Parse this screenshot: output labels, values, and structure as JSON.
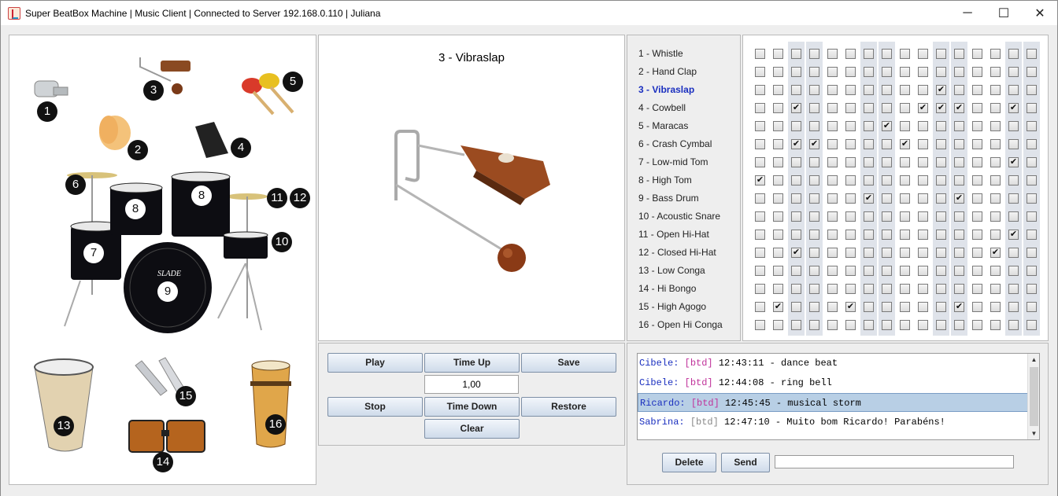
{
  "window": {
    "title": "Super BeatBox Machine | Music Client | Connected to Server 192.168.0.110 | Juliana",
    "controls": {
      "minimize": "─",
      "maximize": "☐",
      "close": "✕"
    }
  },
  "instrument_image": {
    "numbers": [
      "1",
      "2",
      "3",
      "4",
      "5",
      "6",
      "7",
      "8",
      "8",
      "9",
      "10",
      "11",
      "12",
      "13",
      "14",
      "15",
      "16"
    ],
    "brand_text": "SLADE"
  },
  "preview": {
    "title": "3 - Vibraslap"
  },
  "instruments": [
    "1 - Whistle",
    "2 - Hand Clap",
    "3 - Vibraslap",
    "4 - Cowbell",
    "5 - Maracas",
    "6 - Crash Cymbal",
    "7 - Low-mid Tom",
    "8 - High Tom",
    "9 - Bass Drum",
    "10 - Acoustic Snare",
    "11 - Open Hi-Hat",
    "12 - Closed Hi-Hat",
    "13 - Low Conga",
    "14 - Hi Bongo",
    "15 - High Agogo",
    "16 - Open Hi Conga"
  ],
  "selected_instrument_index": 2,
  "beat_grid": [
    [
      0,
      0,
      0,
      0,
      0,
      0,
      0,
      0,
      0,
      0,
      0,
      0,
      0,
      0,
      0,
      0
    ],
    [
      0,
      0,
      0,
      0,
      0,
      0,
      0,
      0,
      0,
      0,
      0,
      0,
      0,
      0,
      0,
      0
    ],
    [
      0,
      0,
      0,
      0,
      0,
      0,
      0,
      0,
      0,
      0,
      1,
      0,
      0,
      0,
      0,
      0
    ],
    [
      0,
      0,
      1,
      0,
      0,
      0,
      0,
      0,
      0,
      1,
      1,
      1,
      0,
      0,
      1,
      0
    ],
    [
      0,
      0,
      0,
      0,
      0,
      0,
      0,
      1,
      0,
      0,
      0,
      0,
      0,
      0,
      0,
      0
    ],
    [
      0,
      0,
      1,
      1,
      0,
      0,
      0,
      0,
      1,
      0,
      0,
      0,
      0,
      0,
      0,
      0
    ],
    [
      0,
      0,
      0,
      0,
      0,
      0,
      0,
      0,
      0,
      0,
      0,
      0,
      0,
      0,
      1,
      0
    ],
    [
      1,
      0,
      0,
      0,
      0,
      0,
      0,
      0,
      0,
      0,
      0,
      0,
      0,
      0,
      0,
      0
    ],
    [
      0,
      0,
      0,
      0,
      0,
      0,
      1,
      0,
      0,
      0,
      0,
      1,
      0,
      0,
      0,
      0
    ],
    [
      0,
      0,
      0,
      0,
      0,
      0,
      0,
      0,
      0,
      0,
      0,
      0,
      0,
      0,
      0,
      0
    ],
    [
      0,
      0,
      0,
      0,
      0,
      0,
      0,
      0,
      0,
      0,
      0,
      0,
      0,
      0,
      1,
      0
    ],
    [
      0,
      0,
      1,
      0,
      0,
      0,
      0,
      0,
      0,
      0,
      0,
      0,
      0,
      1,
      0,
      0
    ],
    [
      0,
      0,
      0,
      0,
      0,
      0,
      0,
      0,
      0,
      0,
      0,
      0,
      0,
      0,
      0,
      0
    ],
    [
      0,
      0,
      0,
      0,
      0,
      0,
      0,
      0,
      0,
      0,
      0,
      0,
      0,
      0,
      0,
      0
    ],
    [
      0,
      1,
      0,
      0,
      0,
      1,
      0,
      0,
      0,
      0,
      0,
      1,
      0,
      0,
      0,
      0
    ],
    [
      0,
      0,
      0,
      0,
      0,
      0,
      0,
      0,
      0,
      0,
      0,
      0,
      0,
      0,
      0,
      0
    ]
  ],
  "check_mark": "✔",
  "controls": {
    "play": "Play",
    "time_up": "Time Up",
    "save": "Save",
    "tempo": "1,00",
    "stop": "Stop",
    "time_down": "Time Down",
    "restore": "Restore",
    "clear": "Clear"
  },
  "chat": {
    "messages": [
      {
        "user": "Cibele:",
        "tag": "[btd]",
        "tag_color": "#c0339b",
        "time": "12:43:11",
        "text": "- dance beat"
      },
      {
        "user": "Cibele:",
        "tag": "[btd]",
        "tag_color": "#c0339b",
        "time": "12:44:08",
        "text": "- ring bell"
      },
      {
        "user": "Ricardo:",
        "tag": "[btd]",
        "tag_color": "#c0339b",
        "time": "12:45:45",
        "text": "- musical storm"
      },
      {
        "user": "Sabrina:",
        "tag": "[btd]",
        "tag_color": "#888888",
        "time": "12:47:10",
        "text": "- Muito bom Ricardo! Parabéns!"
      }
    ],
    "selected_index": 2,
    "delete_label": "Delete",
    "send_label": "Send",
    "input_value": ""
  }
}
